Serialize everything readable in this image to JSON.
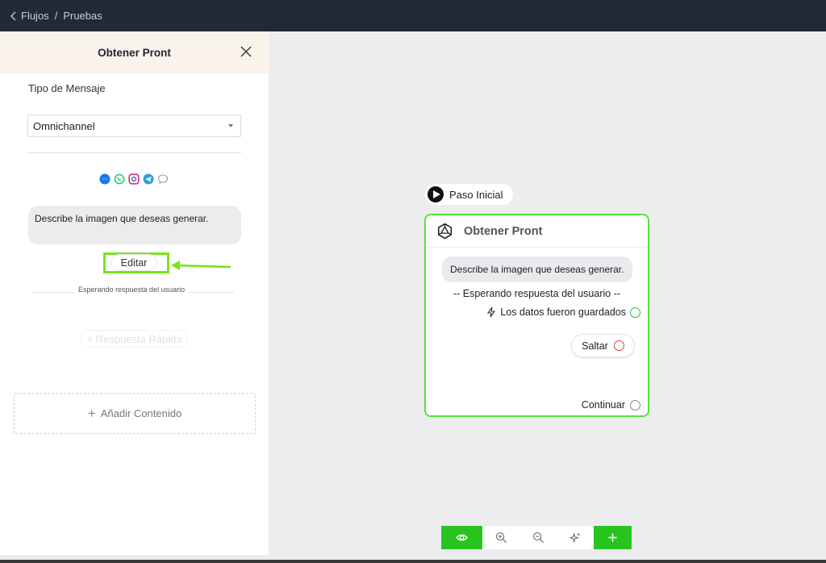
{
  "breadcrumb": {
    "back": "Flujos",
    "separator": "/",
    "current": "Pruebas"
  },
  "panel": {
    "title": "Obtener Pront",
    "message_type_label": "Tipo de Mensaje",
    "message_type_value": "Omnichannel",
    "channel_icons": [
      "messenger-icon",
      "whatsapp-icon",
      "instagram-icon",
      "telegram-icon",
      "chat-bubble-icon"
    ],
    "message_text": "Describe la imagen que deseas generar.",
    "edit_label": "Editar",
    "waiting_text": "Esperando respuesta del usuario",
    "quick_reply_label": "+ Respuesta Rápida",
    "add_content_label": "Añadir Contenido"
  },
  "canvas": {
    "start_label": "Paso Inicial",
    "node": {
      "title": "Obtener Pront",
      "message_text": "Describe la imagen que deseas generar.",
      "waiting_text": "-- Esperando respuesta del usuario --",
      "saved_text": "Los datos fueron guardados",
      "skip_label": "Saltar",
      "continue_label": "Continuar"
    },
    "toolbar": [
      "eye-icon",
      "zoom-in-icon",
      "zoom-out-icon",
      "sparkles-icon",
      "plus-icon"
    ]
  },
  "colors": {
    "accent_green": "#27c41e",
    "node_border": "#57e23a",
    "highlight": "#7be31c",
    "topbar": "#222a38",
    "panel_header": "#f9f3ec"
  }
}
